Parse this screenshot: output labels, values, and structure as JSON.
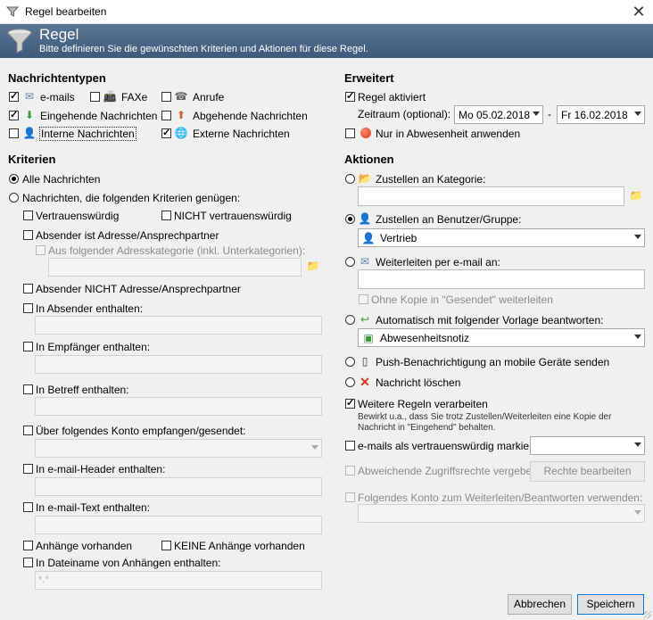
{
  "window": {
    "title": "Regel bearbeiten",
    "close": "✕"
  },
  "banner": {
    "title": "Regel",
    "subtitle": "Bitte definieren Sie die gewünschten Kriterien und Aktionen für diese Regel."
  },
  "nachrichtentypen": {
    "heading": "Nachrichtentypen",
    "emails": "e-mails",
    "faxe": "FAXe",
    "anrufe": "Anrufe",
    "eingehend": "Eingehende Nachrichten",
    "abgehend": "Abgehende Nachrichten",
    "intern": "Interne Nachrichten",
    "extern": "Externe Nachrichten"
  },
  "kriterien": {
    "heading": "Kriterien",
    "alle": "Alle Nachrichten",
    "folgende": "Nachrichten, die folgenden Kriterien genügen:",
    "vertrauen": "Vertrauenswürdig",
    "nicht_vertrauen": "NICHT vertrauenswürdig",
    "absender_adresse": "Absender ist Adresse/Ansprechpartner",
    "adresskategorie": "Aus folgender Adresskategorie (inkl. Unterkategorien):",
    "absender_nicht": "Absender NICHT Adresse/Ansprechpartner",
    "in_absender": "In Absender enthalten:",
    "in_empfaenger": "In Empfänger enthalten:",
    "in_betreff": "In Betreff enthalten:",
    "konto": "Über folgendes Konto empfangen/gesendet:",
    "header": "In e-mail-Header enthalten:",
    "text": "In e-mail-Text enthalten:",
    "anhaenge": "Anhänge vorhanden",
    "keine_anhaenge": "KEINE Anhänge vorhanden",
    "dateiname": "In Dateiname von Anhängen enthalten:",
    "dateiname_placeholder": "*.*"
  },
  "erweitert": {
    "heading": "Erweitert",
    "aktiviert": "Regel aktiviert",
    "zeitraum": "Zeitraum (optional):",
    "von": "Mo 05.02.2018",
    "bis_sep": "-",
    "bis": "Fr 16.02.2018",
    "abwesenheit": "Nur in Abwesenheit anwenden"
  },
  "aktionen": {
    "heading": "Aktionen",
    "kategorie": "Zustellen an Kategorie:",
    "benutzer": "Zustellen an Benutzer/Gruppe:",
    "benutzer_value": "Vertrieb",
    "weiterleiten": "Weiterleiten per e-mail an:",
    "ohne_kopie": "Ohne Kopie in \"Gesendet\" weiterleiten",
    "vorlage": "Automatisch mit folgender Vorlage beantworten:",
    "vorlage_value": "Abwesenheitsnotiz",
    "push": "Push-Benachrichtigung an mobile Geräte senden",
    "loeschen": "Nachricht löschen",
    "weitere": "Weitere Regeln verarbeiten",
    "weitere_note": "Bewirkt u.a., dass Sie trotz Zustellen/Weiterleiten eine Kopie der Nachricht in \"Eingehend\" behalten.",
    "vertrauen_markieren": "e-mails als vertrauenswürdig markieren",
    "zugriffsrechte": "Abweichende Zugriffsrechte vergeben",
    "rechte_btn": "Rechte bearbeiten",
    "konto_weiter": "Folgendes Konto zum Weiterleiten/Beantworten verwenden:"
  },
  "buttons": {
    "abbrechen": "Abbrechen",
    "speichern": "Speichern"
  },
  "colors": {
    "banner": "#4a6686",
    "accent": "#0078d7"
  }
}
